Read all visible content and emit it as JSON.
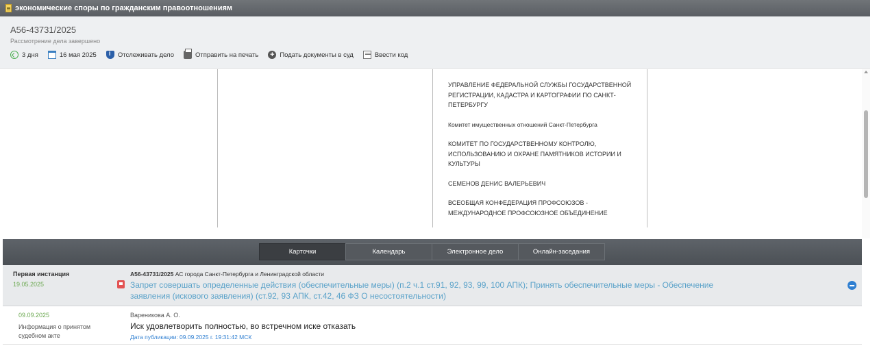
{
  "window": {
    "title": "экономические споры по гражданским правоотношениям"
  },
  "case": {
    "number": "А56-43731/2025",
    "status": "Рассмотрение дела завершено"
  },
  "toolbar": {
    "days": "3 дня",
    "date": "16 мая 2025",
    "track": "Отслеживать дело",
    "print": "Отправить на печать",
    "submit": "Подать документы в суд",
    "code": "Ввести код"
  },
  "parties": [
    "УПРАВЛЕНИЕ ФЕДЕРАЛЬНОЙ СЛУЖБЫ ГОСУДАРСТВЕННОЙ РЕГИСТРАЦИИ, КАДАСТРА И КАРТОГРАФИИ ПО САНКТ-ПЕТЕРБУРГУ",
    "Комитет имущественных отношений Санкт-Петербурга",
    "КОМИТЕТ ПО ГОСУДАРСТВЕННОМУ КОНТРОЛЮ, ИСПОЛЬЗОВАНИЮ И ОХРАНЕ ПАМЯТНИКОВ ИСТОРИИ И КУЛЬТУРЫ",
    "СЕМЕНОВ ДЕНИС ВАЛЕРЬЕВИЧ",
    "ВСЕОБЩАЯ КОНФЕДЕРАЦИЯ ПРОФСОЮЗОВ - МЕЖДУНАРОДНОЕ ПРОФСОЮЗНОЕ ОБЪЕДИНЕНИЕ"
  ],
  "tabs": [
    {
      "label": "Карточки",
      "active": true
    },
    {
      "label": "Календарь",
      "active": false
    },
    {
      "label": "Электронное дело",
      "active": false
    },
    {
      "label": "Онлайн-заседания",
      "active": false
    }
  ],
  "instance": {
    "title": "Первая инстанция",
    "date": "19.05.2025",
    "case_number": "А56-43731/2025",
    "court": "АС города Санкт-Петербурга и Ленинградской области",
    "document_link": "Запрет совершать определенные действия (обеспечительные меры) (п.2 ч.1 ст.91, 92, 93, 99, 100 АПК); Принять обеспечительные меры - Обеспечение заявления (искового заявления) (ст.92, 93 АПК, ст.42, 46 ФЗ О несостоятельности)"
  },
  "act": {
    "date": "09.09.2025",
    "type": "Информация о принятом судебном акте",
    "judge": "Вареникова А. О.",
    "result": "Иск удовлетворить полностью, во встречном иске отказать",
    "published": "Дата публикации: 09.09.2025 г. 19:31:42 МСК"
  },
  "colors": {
    "accent_green": "#6aa84f",
    "link_blue": "#5aa2c9",
    "header_dark": "#5a5e63"
  }
}
